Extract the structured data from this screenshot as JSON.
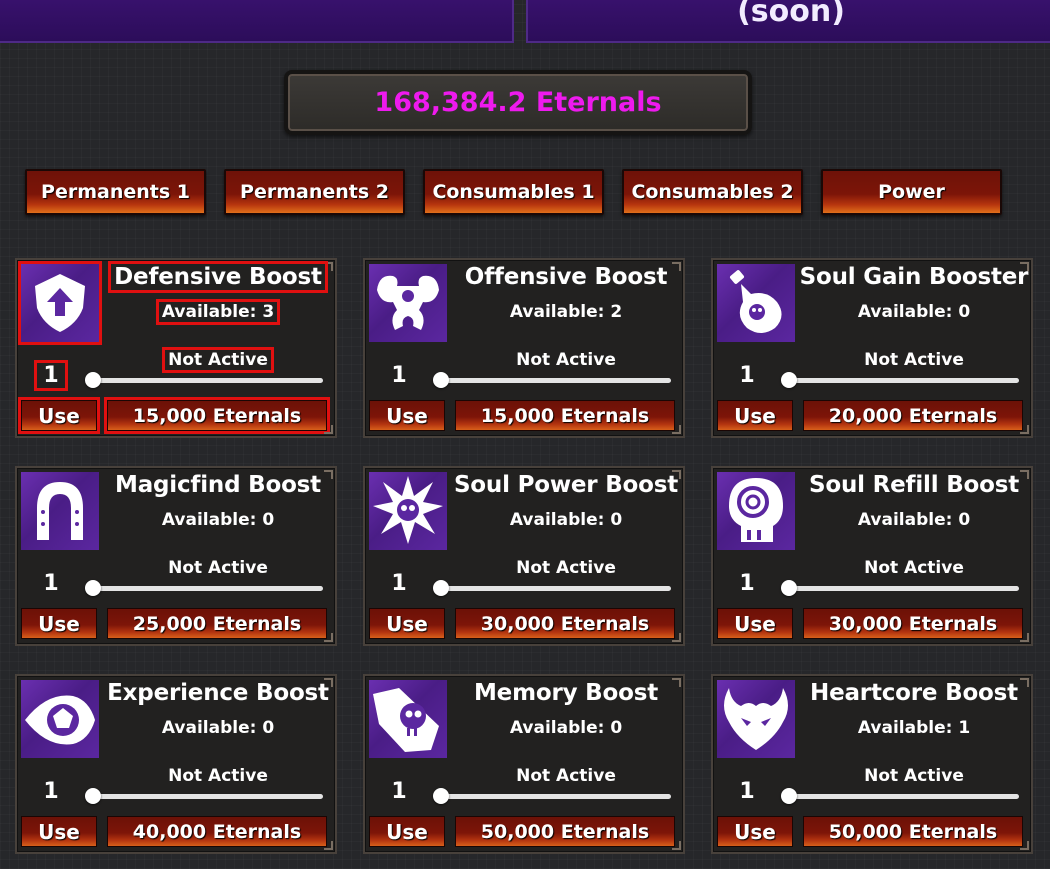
{
  "top": {
    "right_label": "(soon)"
  },
  "currency": {
    "text": "168,384.2 Eternals",
    "color": "#ee1aee"
  },
  "tabs": [
    "Permanents 1",
    "Permanents 2",
    "Consumables 1",
    "Consumables 2",
    "Power"
  ],
  "items": [
    {
      "name": "Defensive Boost",
      "available": "Available: 3",
      "status": "Not Active",
      "qty": "1",
      "use": "Use",
      "price": "15,000 Eternals",
      "icon": "shield-arrow-icon"
    },
    {
      "name": "Offensive Boost",
      "available": "Available: 2",
      "status": "Not Active",
      "qty": "1",
      "use": "Use",
      "price": "15,000 Eternals",
      "icon": "muscle-icon"
    },
    {
      "name": "Soul Gain Booster",
      "available": "Available: 0",
      "status": "Not Active",
      "qty": "1",
      "use": "Use",
      "price": "20,000 Eternals",
      "icon": "potion-skull-icon"
    },
    {
      "name": "Magicfind Boost",
      "available": "Available: 0",
      "status": "Not Active",
      "qty": "1",
      "use": "Use",
      "price": "25,000 Eternals",
      "icon": "horseshoe-icon"
    },
    {
      "name": "Soul Power Boost",
      "available": "Available: 0",
      "status": "Not Active",
      "qty": "1",
      "use": "Use",
      "price": "30,000 Eternals",
      "icon": "skull-burst-icon"
    },
    {
      "name": "Soul Refill Boost",
      "available": "Available: 0",
      "status": "Not Active",
      "qty": "1",
      "use": "Use",
      "price": "30,000 Eternals",
      "icon": "skull-spiral-icon"
    },
    {
      "name": "Experience Boost",
      "available": "Available: 0",
      "status": "Not Active",
      "qty": "1",
      "use": "Use",
      "price": "40,000 Eternals",
      "icon": "eye-icon"
    },
    {
      "name": "Memory Boost",
      "available": "Available: 0",
      "status": "Not Active",
      "qty": "1",
      "use": "Use",
      "price": "50,000 Eternals",
      "icon": "skull-hand-icon"
    },
    {
      "name": "Heartcore Boost",
      "available": "Available: 1",
      "status": "Not Active",
      "qty": "1",
      "use": "Use",
      "price": "50,000 Eternals",
      "icon": "demon-heart-icon"
    }
  ]
}
